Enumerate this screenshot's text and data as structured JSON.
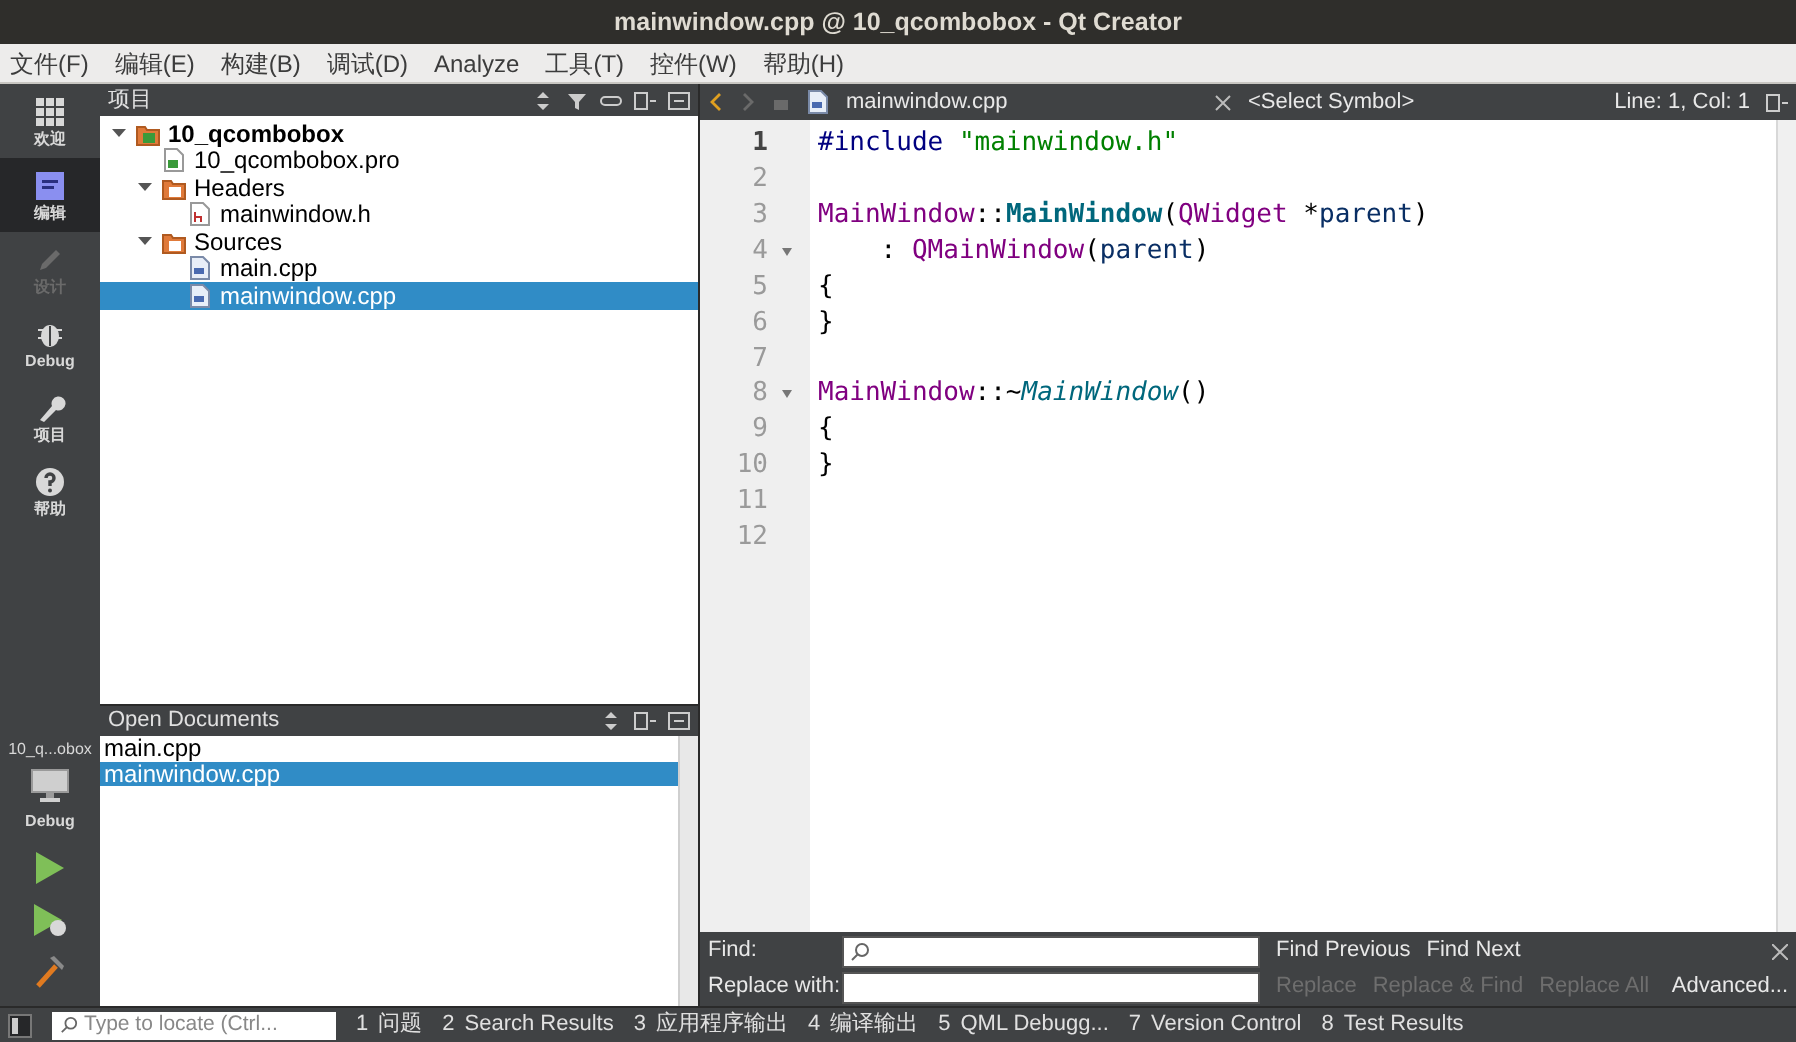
{
  "window": {
    "title": "mainwindow.cpp @ 10_qcombobox - Qt Creator"
  },
  "menu": [
    "文件(F)",
    "编辑(E)",
    "构建(B)",
    "调试(D)",
    "Analyze",
    "工具(T)",
    "控件(W)",
    "帮助(H)"
  ],
  "modes": [
    {
      "label": "欢迎",
      "kind": "welcome",
      "selected": false,
      "disabled": false
    },
    {
      "label": "编辑",
      "kind": "edit",
      "selected": true,
      "disabled": false
    },
    {
      "label": "设计",
      "kind": "design",
      "selected": false,
      "disabled": true
    },
    {
      "label": "Debug",
      "kind": "debug",
      "selected": false,
      "disabled": false
    },
    {
      "label": "项目",
      "kind": "projects",
      "selected": false,
      "disabled": false
    },
    {
      "label": "帮助",
      "kind": "help",
      "selected": false,
      "disabled": false
    }
  ],
  "kit": {
    "project": "10_q...obox",
    "build": "Debug"
  },
  "project_panel": {
    "title": "项目",
    "tree": [
      {
        "label": "10_qcombobox",
        "kind": "project",
        "expanded": true,
        "selected": false,
        "children": [
          {
            "label": "10_qcombobox.pro",
            "kind": "pro",
            "selected": false
          },
          {
            "label": "Headers",
            "kind": "folder-h",
            "expanded": true,
            "selected": false,
            "children": [
              {
                "label": "mainwindow.h",
                "kind": "header",
                "selected": false
              }
            ]
          },
          {
            "label": "Sources",
            "kind": "folder-cpp",
            "expanded": true,
            "selected": false,
            "children": [
              {
                "label": "main.cpp",
                "kind": "source",
                "selected": false
              },
              {
                "label": "mainwindow.cpp",
                "kind": "source",
                "selected": true
              }
            ]
          }
        ]
      }
    ]
  },
  "open_documents": {
    "title": "Open Documents",
    "items": [
      {
        "label": "main.cpp",
        "selected": false
      },
      {
        "label": "mainwindow.cpp",
        "selected": true
      }
    ]
  },
  "editor": {
    "file": "mainwindow.cpp",
    "symbol": "<Select Symbol>",
    "position": "Line: 1, Col: 1",
    "lines": [
      {
        "number": "1",
        "current": true,
        "fold": false,
        "tokens": [
          {
            "kind": "preprocessor",
            "text": "#include"
          },
          {
            "kind": "string",
            "text": " \"mainwindow.h\""
          }
        ]
      },
      {
        "number": "2",
        "current": false,
        "fold": false
      },
      {
        "number": "3",
        "current": false,
        "fold": false,
        "tokens": [
          {
            "kind": "type",
            "text": "MainWindow"
          },
          {
            "kind": "plain",
            "text": "::"
          },
          {
            "kind": "function",
            "text": "MainWindow"
          },
          {
            "kind": "plain",
            "text": "("
          },
          {
            "kind": "type",
            "text": "QWidget"
          },
          {
            "kind": "plain",
            "text": " *"
          },
          {
            "kind": "param",
            "text": "parent"
          },
          {
            "kind": "plain",
            "text": ")"
          }
        ]
      },
      {
        "number": "4",
        "current": false,
        "fold": true,
        "tokens": [
          {
            "kind": "plain",
            "text": "    : "
          },
          {
            "kind": "type",
            "text": "QMainWindow"
          },
          {
            "kind": "plain",
            "text": "("
          },
          {
            "kind": "param",
            "text": "parent"
          },
          {
            "kind": "plain",
            "text": ")"
          }
        ]
      },
      {
        "number": "5",
        "current": false,
        "fold": false,
        "tokens": [
          {
            "kind": "plain",
            "text": "{"
          }
        ]
      },
      {
        "number": "6",
        "current": false,
        "fold": false,
        "tokens": [
          {
            "kind": "plain",
            "text": "}"
          }
        ]
      },
      {
        "number": "7",
        "current": false,
        "fold": false
      },
      {
        "number": "8",
        "current": false,
        "fold": true,
        "tokens": [
          {
            "kind": "type",
            "text": "MainWindow"
          },
          {
            "kind": "plain",
            "text": "::~"
          },
          {
            "kind": "destructor",
            "text": "MainWindow"
          },
          {
            "kind": "plain",
            "text": "()"
          }
        ]
      },
      {
        "number": "9",
        "current": false,
        "fold": false,
        "tokens": [
          {
            "kind": "plain",
            "text": "{"
          }
        ]
      },
      {
        "number": "10",
        "current": false,
        "fold": false,
        "tokens": [
          {
            "kind": "plain",
            "text": "}"
          }
        ]
      },
      {
        "number": "11",
        "current": false,
        "fold": false
      },
      {
        "number": "12",
        "current": false,
        "fold": false
      }
    ]
  },
  "find": {
    "find_label": "Find:",
    "replace_label": "Replace with:",
    "buttons": [
      {
        "label": "Find Previous",
        "disabled": false
      },
      {
        "label": "Find Next",
        "disabled": false
      }
    ],
    "replace_buttons": [
      {
        "label": "Replace",
        "disabled": true
      },
      {
        "label": "Replace & Find",
        "disabled": true
      },
      {
        "label": "Replace All",
        "disabled": true
      }
    ],
    "advanced": "Advanced..."
  },
  "status_bar": {
    "locator": {
      "placeholder": "Type to locate (Ctrl..."
    },
    "panes": [
      {
        "number": "1",
        "label": "问题"
      },
      {
        "number": "2",
        "label": "Search Results"
      },
      {
        "number": "3",
        "label": "应用程序输出"
      },
      {
        "number": "4",
        "label": "编译输出"
      },
      {
        "number": "5",
        "label": "QML Debugg..."
      },
      {
        "number": "7",
        "label": "Version Control"
      },
      {
        "number": "8",
        "label": "Test Results"
      }
    ]
  }
}
